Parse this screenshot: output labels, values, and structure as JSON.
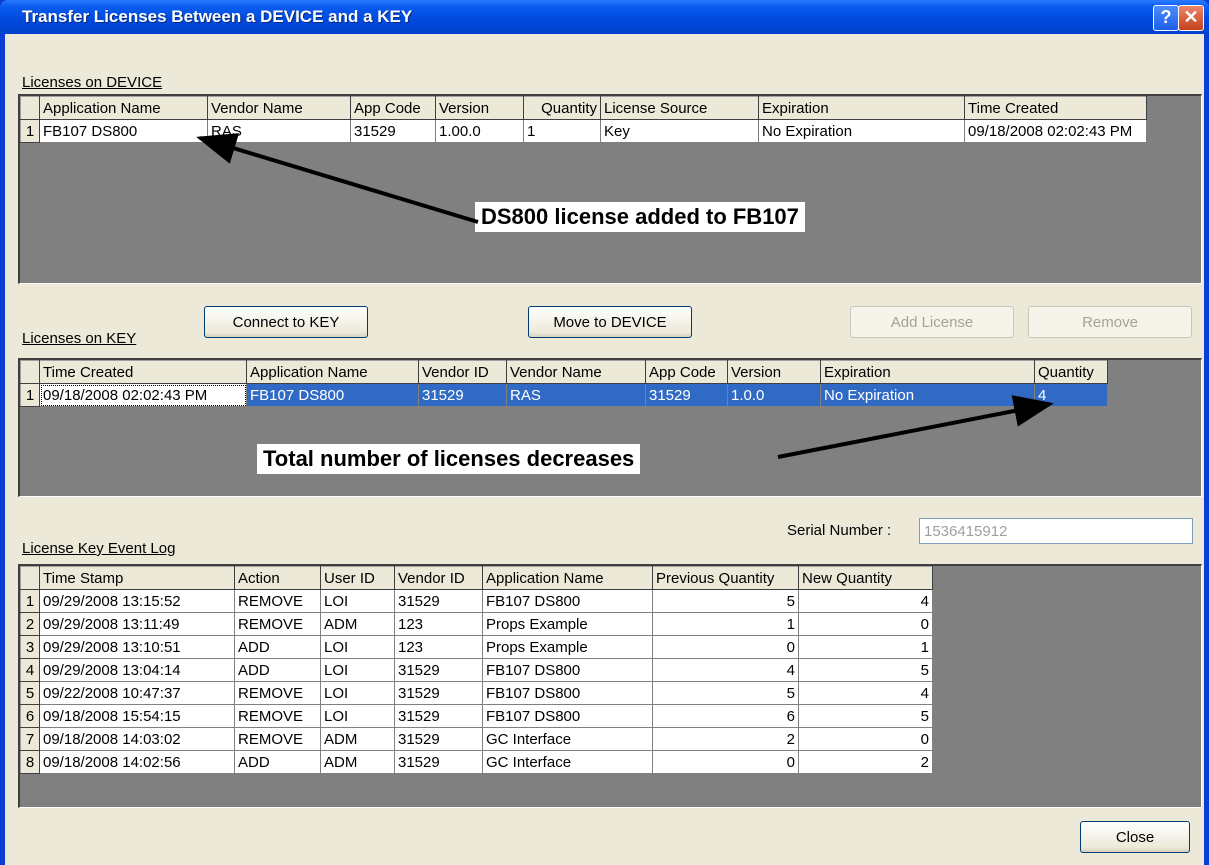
{
  "window": {
    "title": "Transfer Licenses Between a DEVICE and a KEY",
    "help": "?",
    "close": "✕"
  },
  "device": {
    "label": "Licenses on DEVICE",
    "columns": [
      "Application Name",
      "Vendor Name",
      "App Code",
      "Version",
      "Quantity",
      "License Source",
      "Expiration",
      "Time Created"
    ],
    "rows": [
      {
        "n": "1",
        "cells": [
          "FB107 DS800",
          "RAS",
          "31529",
          "1.00.0",
          "1",
          "Key",
          "No Expiration",
          "09/18/2008 02:02:43 PM"
        ]
      }
    ]
  },
  "buttons": {
    "connect": "Connect to KEY",
    "move": "Move to DEVICE",
    "add": "Add License",
    "remove": "Remove",
    "close": "Close"
  },
  "key": {
    "label": "Licenses on KEY",
    "columns": [
      "Time Created",
      "Application Name",
      "Vendor ID",
      "Vendor Name",
      "App Code",
      "Version",
      "Expiration",
      "Quantity"
    ],
    "rows": [
      {
        "n": "1",
        "cells": [
          "09/18/2008 02:02:43 PM",
          "FB107 DS800",
          "31529",
          "RAS",
          "31529",
          "1.0.0",
          "No Expiration",
          "4"
        ]
      }
    ]
  },
  "serial": {
    "label": "Serial Number :",
    "value": "1536415912"
  },
  "log": {
    "label": "License Key Event Log",
    "columns": [
      "Time Stamp",
      "Action",
      "User ID",
      "Vendor ID",
      "Application Name",
      "Previous Quantity",
      "New Quantity"
    ],
    "rows": [
      {
        "n": "1",
        "cells": [
          "09/29/2008 13:15:52",
          "REMOVE",
          "LOI",
          "31529",
          "FB107 DS800",
          "5",
          "4"
        ]
      },
      {
        "n": "2",
        "cells": [
          "09/29/2008 13:11:49",
          "REMOVE",
          "ADM",
          "123",
          "Props Example",
          "1",
          "0"
        ]
      },
      {
        "n": "3",
        "cells": [
          "09/29/2008 13:10:51",
          "ADD",
          "LOI",
          "123",
          "Props Example",
          "0",
          "1"
        ]
      },
      {
        "n": "4",
        "cells": [
          "09/29/2008 13:04:14",
          "ADD",
          "LOI",
          "31529",
          "FB107 DS800",
          "4",
          "5"
        ]
      },
      {
        "n": "5",
        "cells": [
          "09/22/2008 10:47:37",
          "REMOVE",
          "LOI",
          "31529",
          "FB107 DS800",
          "5",
          "4"
        ]
      },
      {
        "n": "6",
        "cells": [
          "09/18/2008 15:54:15",
          "REMOVE",
          "LOI",
          "31529",
          "FB107 DS800",
          "6",
          "5"
        ]
      },
      {
        "n": "7",
        "cells": [
          "09/18/2008 14:03:02",
          "REMOVE",
          "ADM",
          "31529",
          "GC Interface",
          "2",
          "0"
        ]
      },
      {
        "n": "8",
        "cells": [
          "09/18/2008 14:02:56",
          "ADD",
          "ADM",
          "31529",
          "GC Interface",
          "0",
          "2"
        ]
      }
    ]
  },
  "annotations": {
    "device_callout": "DS800 license added to FB107",
    "key_callout": "Total number of licenses decreases"
  }
}
